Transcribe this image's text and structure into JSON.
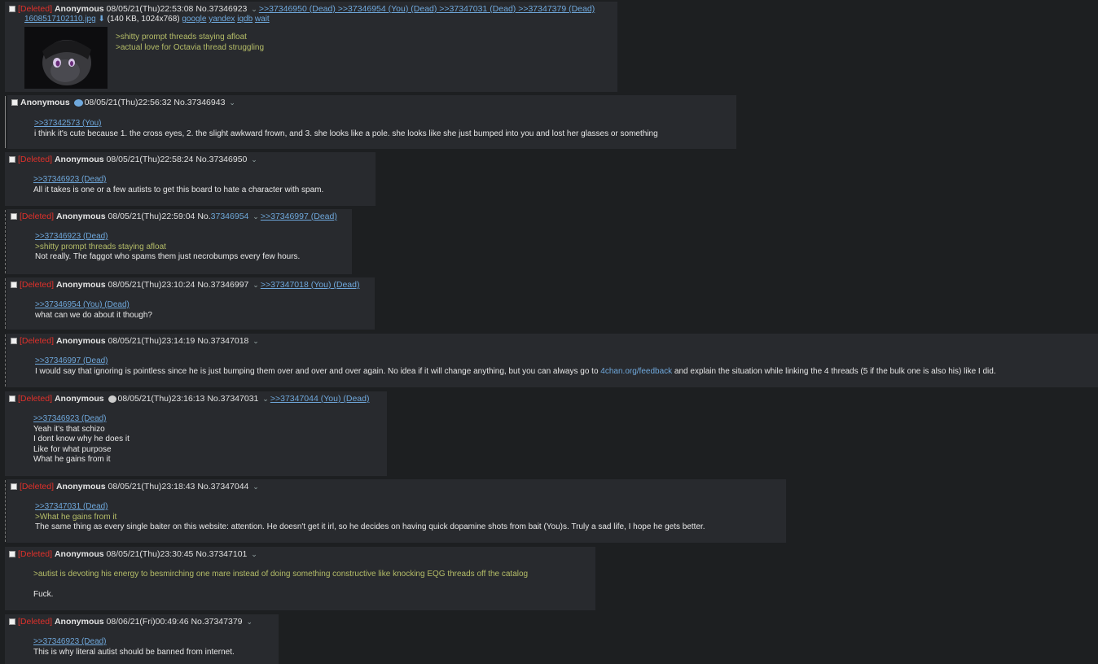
{
  "posts": [
    {
      "deleted": "[Deleted]",
      "name": "Anonymous",
      "date": "08/05/21(Thu)22:53:08",
      "no": "No.37346923",
      "replies": ">>37346950 (Dead) >>37346954 (You) (Dead) >>37347031 (Dead) >>37347379 (Dead)",
      "file": {
        "name": "1608517102110.jpg",
        "size": "(140 KB, 1024x768)",
        "links": [
          "google",
          "yandex",
          "iqdb",
          "wait"
        ]
      },
      "lines": [
        ">shitty prompt threads staying afloat",
        ">actual love for Octavia thread struggling"
      ]
    },
    {
      "name": "Anonymous",
      "date": "08/05/21(Thu)22:56:32",
      "no": "No.37346943",
      "quote": ">>37342573 (You)",
      "lines": [
        "i think it's cute because 1. the cross eyes, 2. the slight awkward frown, and 3. she looks like a pole. she looks like she just bumped into you and lost her glasses or something"
      ]
    },
    {
      "deleted": "[Deleted]",
      "name": "Anonymous",
      "date": "08/05/21(Thu)22:58:24",
      "no": "No.37346950",
      "quote": ">>37346923 (Dead)",
      "lines": [
        "All it takes is one or a few autists to get this board to hate a character with spam."
      ]
    },
    {
      "deleted": "[Deleted]",
      "name": "Anonymous",
      "date": "08/05/21(Thu)22:59:04",
      "no": "No.",
      "nolink": "37346954",
      "replies": ">>37346997 (Dead)",
      "quote": ">>37346923 (Dead)",
      "greentext": ">shitty prompt threads staying afloat",
      "lines": [
        "Not really. The faggot who spams them just necrobumps every few hours."
      ]
    },
    {
      "deleted": "[Deleted]",
      "name": "Anonymous",
      "date": "08/05/21(Thu)23:10:24",
      "no": "No.37346997",
      "replies": ">>37347018 (You) (Dead)",
      "quote": ">>37346954 (You) (Dead)",
      "lines": [
        "what can we do about it though?"
      ]
    },
    {
      "deleted": "[Deleted]",
      "name": "Anonymous",
      "date": "08/05/21(Thu)23:14:19",
      "no": "No.37347018",
      "quote": ">>37346997 (Dead)",
      "line_a": "I would say that ignoring is pointless since he is just bumping them over and over and over again. No idea if it will change anything, but you can always go to ",
      "link": "4chan.org/feedback",
      "line_b": " and explain the situation while linking the 4 threads (5 if the bulk one is also his) like I did."
    },
    {
      "deleted": "[Deleted]",
      "name": "Anonymous",
      "date": "08/05/21(Thu)23:16:13",
      "no": "No.37347031",
      "replies": ">>37347044 (You) (Dead)",
      "quote": ">>37346923 (Dead)",
      "lines": [
        "Yeah it's that schizo",
        "I dont know why he does it",
        "Like for what purpose",
        "What he gains from it"
      ]
    },
    {
      "deleted": "[Deleted]",
      "name": "Anonymous",
      "date": "08/05/21(Thu)23:18:43",
      "no": "No.37347044",
      "quote": ">>37347031 (Dead)",
      "greentext": ">What he gains from it",
      "lines": [
        "The same thing as every single baiter on this website: attention. He doesn't get it irl, so he decides on having quick dopamine shots from bait (You)s. Truly a sad life, I hope he gets better."
      ]
    },
    {
      "deleted": "[Deleted]",
      "name": "Anonymous",
      "date": "08/05/21(Thu)23:30:45",
      "no": "No.37347101",
      "greentext": ">autist is devoting his energy to besmirching one mare instead of doing something constructive like knocking EQG threads off the catalog",
      "lines": [
        "Fuck."
      ]
    },
    {
      "deleted": "[Deleted]",
      "name": "Anonymous",
      "date": "08/06/21(Fri)00:49:46",
      "no": "No.37347379",
      "quote": ">>37346923 (Dead)",
      "lines": [
        "This is why literal autist should be banned from internet."
      ]
    }
  ]
}
